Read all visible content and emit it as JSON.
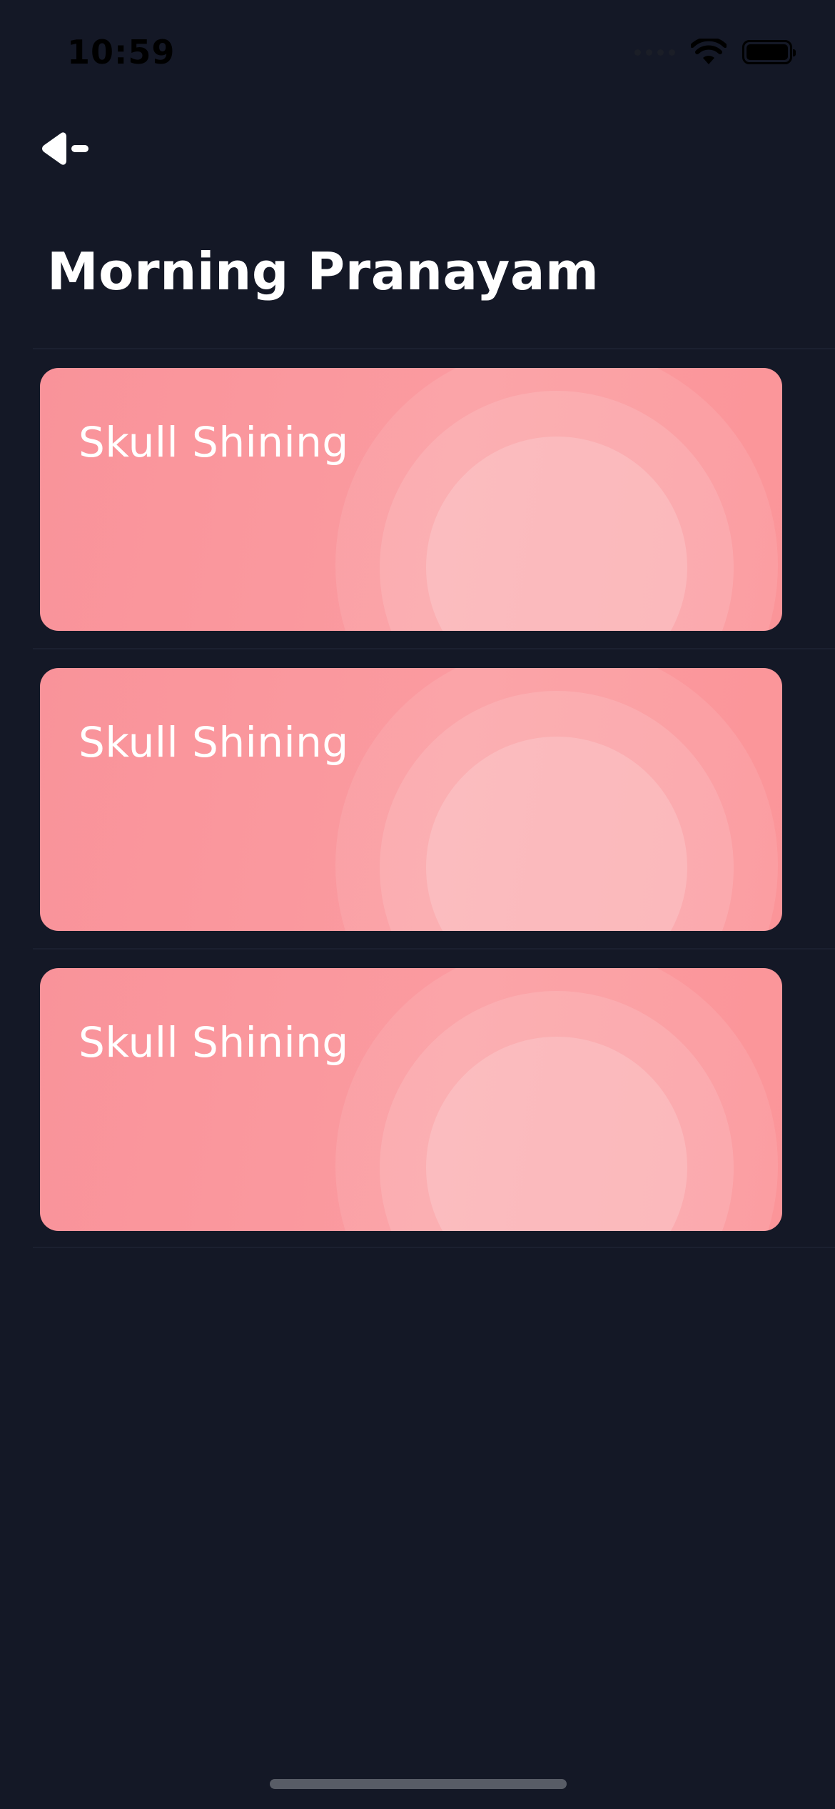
{
  "status_bar": {
    "time": "10:59",
    "icons": [
      "cellular-signal-icon",
      "wifi-icon",
      "battery-icon"
    ]
  },
  "header": {
    "back_icon": "back-arrow-icon",
    "title": "Morning Pranayam"
  },
  "sessions": [
    {
      "title": "Skull Shining"
    },
    {
      "title": "Skull Shining"
    },
    {
      "title": "Skull Shining"
    }
  ],
  "colors": {
    "background": "#141826",
    "card": "#f9939a",
    "text": "#ffffff"
  }
}
